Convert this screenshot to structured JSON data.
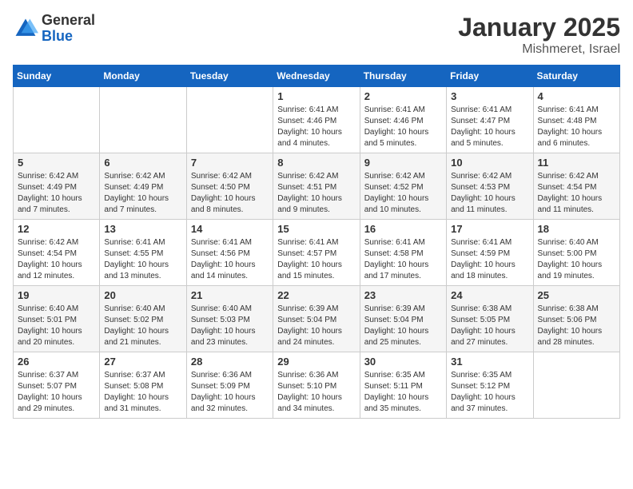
{
  "header": {
    "logo_general": "General",
    "logo_blue": "Blue",
    "month_year": "January 2025",
    "location": "Mishmeret, Israel"
  },
  "days_of_week": [
    "Sunday",
    "Monday",
    "Tuesday",
    "Wednesday",
    "Thursday",
    "Friday",
    "Saturday"
  ],
  "weeks": [
    [
      {
        "day": "",
        "info": ""
      },
      {
        "day": "",
        "info": ""
      },
      {
        "day": "",
        "info": ""
      },
      {
        "day": "1",
        "info": "Sunrise: 6:41 AM\nSunset: 4:46 PM\nDaylight: 10 hours\nand 4 minutes."
      },
      {
        "day": "2",
        "info": "Sunrise: 6:41 AM\nSunset: 4:46 PM\nDaylight: 10 hours\nand 5 minutes."
      },
      {
        "day": "3",
        "info": "Sunrise: 6:41 AM\nSunset: 4:47 PM\nDaylight: 10 hours\nand 5 minutes."
      },
      {
        "day": "4",
        "info": "Sunrise: 6:41 AM\nSunset: 4:48 PM\nDaylight: 10 hours\nand 6 minutes."
      }
    ],
    [
      {
        "day": "5",
        "info": "Sunrise: 6:42 AM\nSunset: 4:49 PM\nDaylight: 10 hours\nand 7 minutes."
      },
      {
        "day": "6",
        "info": "Sunrise: 6:42 AM\nSunset: 4:49 PM\nDaylight: 10 hours\nand 7 minutes."
      },
      {
        "day": "7",
        "info": "Sunrise: 6:42 AM\nSunset: 4:50 PM\nDaylight: 10 hours\nand 8 minutes."
      },
      {
        "day": "8",
        "info": "Sunrise: 6:42 AM\nSunset: 4:51 PM\nDaylight: 10 hours\nand 9 minutes."
      },
      {
        "day": "9",
        "info": "Sunrise: 6:42 AM\nSunset: 4:52 PM\nDaylight: 10 hours\nand 10 minutes."
      },
      {
        "day": "10",
        "info": "Sunrise: 6:42 AM\nSunset: 4:53 PM\nDaylight: 10 hours\nand 11 minutes."
      },
      {
        "day": "11",
        "info": "Sunrise: 6:42 AM\nSunset: 4:54 PM\nDaylight: 10 hours\nand 11 minutes."
      }
    ],
    [
      {
        "day": "12",
        "info": "Sunrise: 6:42 AM\nSunset: 4:54 PM\nDaylight: 10 hours\nand 12 minutes."
      },
      {
        "day": "13",
        "info": "Sunrise: 6:41 AM\nSunset: 4:55 PM\nDaylight: 10 hours\nand 13 minutes."
      },
      {
        "day": "14",
        "info": "Sunrise: 6:41 AM\nSunset: 4:56 PM\nDaylight: 10 hours\nand 14 minutes."
      },
      {
        "day": "15",
        "info": "Sunrise: 6:41 AM\nSunset: 4:57 PM\nDaylight: 10 hours\nand 15 minutes."
      },
      {
        "day": "16",
        "info": "Sunrise: 6:41 AM\nSunset: 4:58 PM\nDaylight: 10 hours\nand 17 minutes."
      },
      {
        "day": "17",
        "info": "Sunrise: 6:41 AM\nSunset: 4:59 PM\nDaylight: 10 hours\nand 18 minutes."
      },
      {
        "day": "18",
        "info": "Sunrise: 6:40 AM\nSunset: 5:00 PM\nDaylight: 10 hours\nand 19 minutes."
      }
    ],
    [
      {
        "day": "19",
        "info": "Sunrise: 6:40 AM\nSunset: 5:01 PM\nDaylight: 10 hours\nand 20 minutes."
      },
      {
        "day": "20",
        "info": "Sunrise: 6:40 AM\nSunset: 5:02 PM\nDaylight: 10 hours\nand 21 minutes."
      },
      {
        "day": "21",
        "info": "Sunrise: 6:40 AM\nSunset: 5:03 PM\nDaylight: 10 hours\nand 23 minutes."
      },
      {
        "day": "22",
        "info": "Sunrise: 6:39 AM\nSunset: 5:04 PM\nDaylight: 10 hours\nand 24 minutes."
      },
      {
        "day": "23",
        "info": "Sunrise: 6:39 AM\nSunset: 5:04 PM\nDaylight: 10 hours\nand 25 minutes."
      },
      {
        "day": "24",
        "info": "Sunrise: 6:38 AM\nSunset: 5:05 PM\nDaylight: 10 hours\nand 27 minutes."
      },
      {
        "day": "25",
        "info": "Sunrise: 6:38 AM\nSunset: 5:06 PM\nDaylight: 10 hours\nand 28 minutes."
      }
    ],
    [
      {
        "day": "26",
        "info": "Sunrise: 6:37 AM\nSunset: 5:07 PM\nDaylight: 10 hours\nand 29 minutes."
      },
      {
        "day": "27",
        "info": "Sunrise: 6:37 AM\nSunset: 5:08 PM\nDaylight: 10 hours\nand 31 minutes."
      },
      {
        "day": "28",
        "info": "Sunrise: 6:36 AM\nSunset: 5:09 PM\nDaylight: 10 hours\nand 32 minutes."
      },
      {
        "day": "29",
        "info": "Sunrise: 6:36 AM\nSunset: 5:10 PM\nDaylight: 10 hours\nand 34 minutes."
      },
      {
        "day": "30",
        "info": "Sunrise: 6:35 AM\nSunset: 5:11 PM\nDaylight: 10 hours\nand 35 minutes."
      },
      {
        "day": "31",
        "info": "Sunrise: 6:35 AM\nSunset: 5:12 PM\nDaylight: 10 hours\nand 37 minutes."
      },
      {
        "day": "",
        "info": ""
      }
    ]
  ]
}
